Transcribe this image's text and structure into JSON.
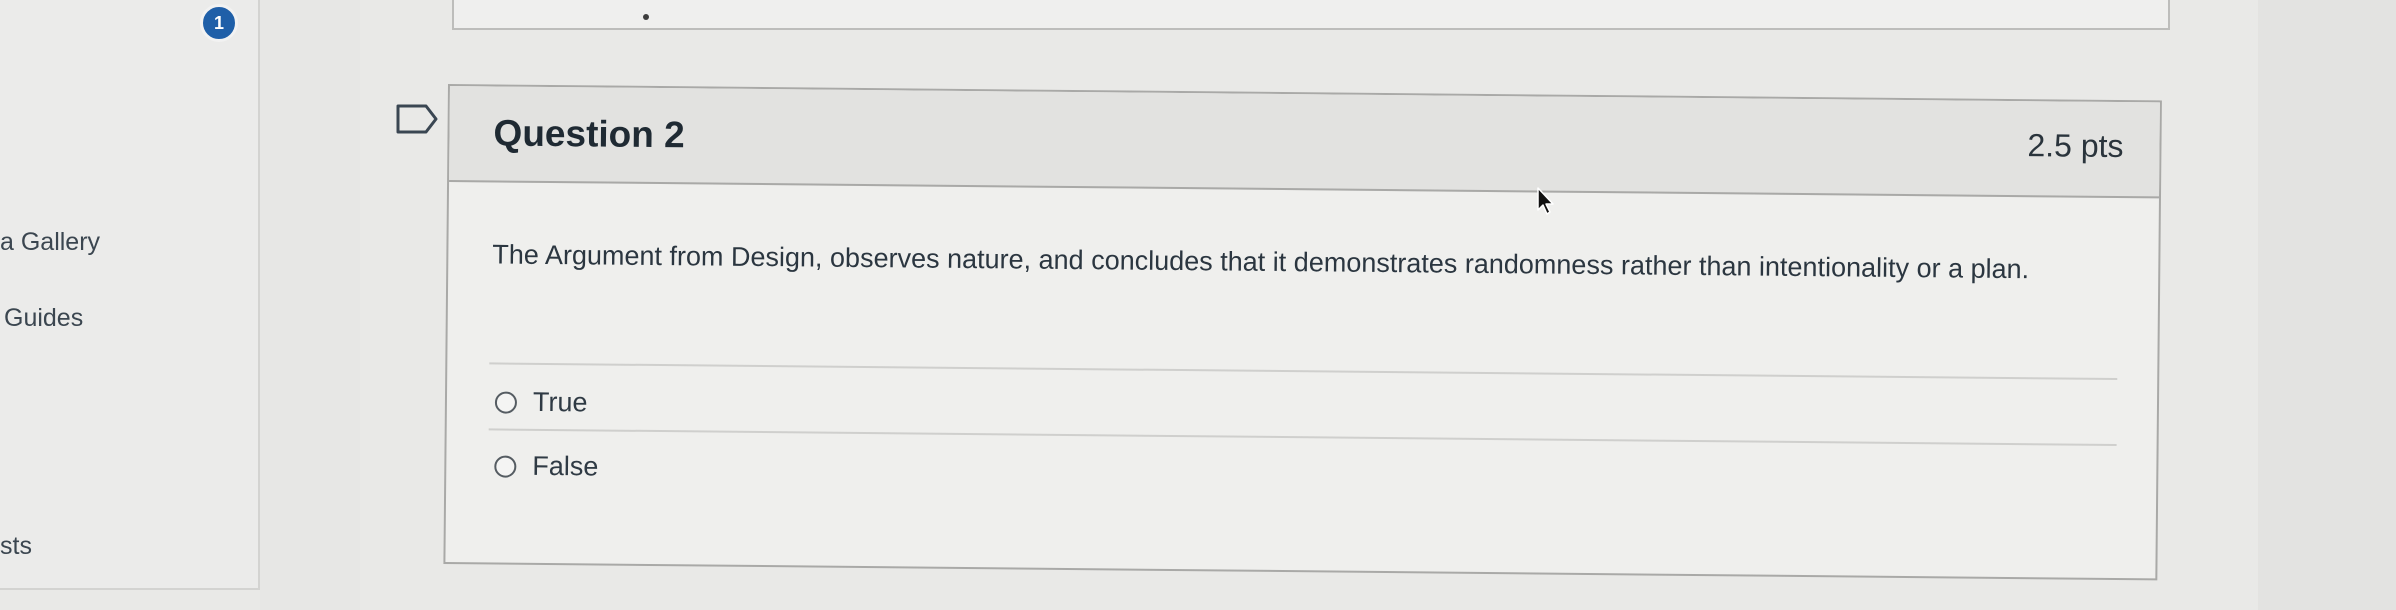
{
  "sidebar": {
    "badge_count": "1",
    "items": [
      {
        "label": "a Gallery"
      },
      {
        "label": "Guides"
      },
      {
        "label": "sts"
      }
    ]
  },
  "question": {
    "title": "Question 2",
    "points": "2.5 pts",
    "text": "The Argument from Design, observes nature, and concludes that it demonstrates randomness rather than intentionality or a plan.",
    "answers": [
      {
        "label": "True",
        "selected": false
      },
      {
        "label": "False",
        "selected": false
      }
    ]
  },
  "icons": {
    "flag": "flag-outline-icon",
    "cursor": "mouse-pointer-icon"
  },
  "colors": {
    "badge": "#1f5fa8",
    "header_bg": "#e2e2e0",
    "border": "#a9a9a7"
  }
}
